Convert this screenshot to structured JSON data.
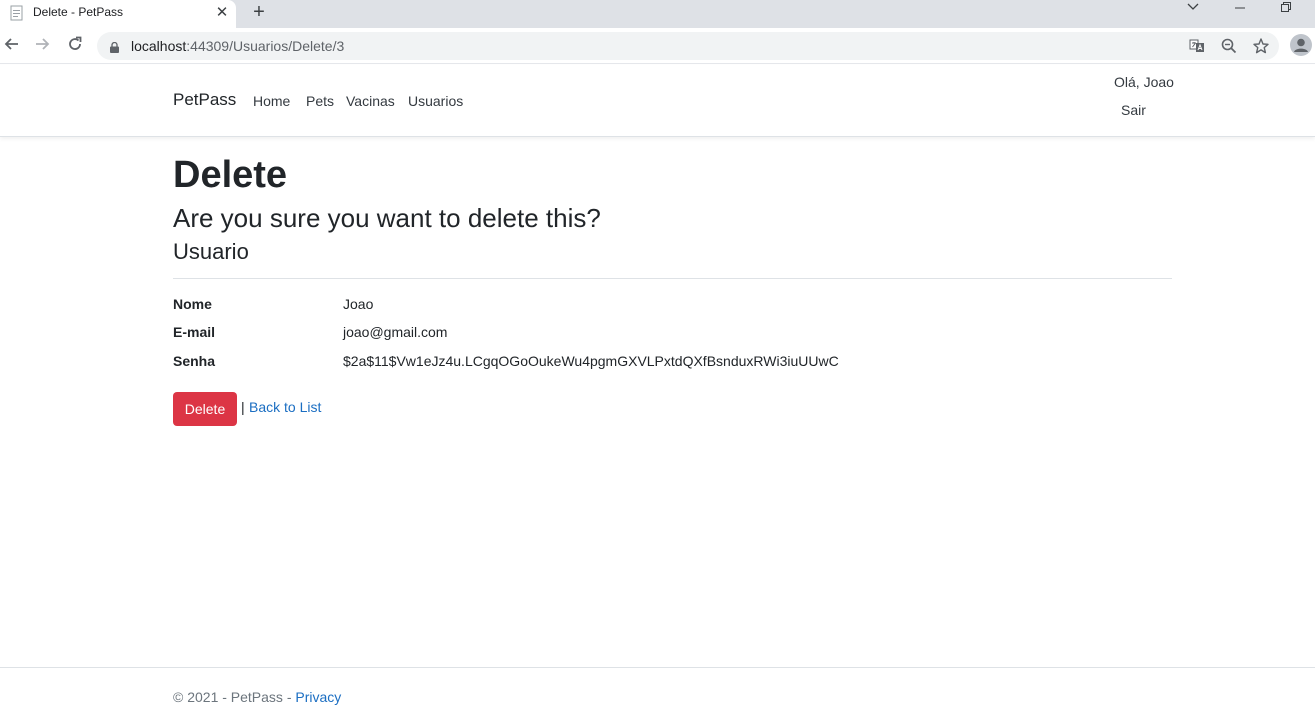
{
  "browser": {
    "tab_title": "Delete - PetPass",
    "tab_close": "✕",
    "new_tab": "+",
    "url_host": "localhost",
    "url_path": ":44309/Usuarios/Delete/3"
  },
  "navbar": {
    "brand": "PetPass",
    "links": [
      "Home",
      "Pets",
      "Vacinas",
      "Usuarios"
    ],
    "greeting": "Olá, Joao",
    "logout": "Sair"
  },
  "page": {
    "title": "Delete",
    "question": "Are you sure you want to delete this?",
    "entity": "Usuario",
    "fields": [
      {
        "label": "Nome",
        "value": "Joao"
      },
      {
        "label": "E-mail",
        "value": "joao@gmail.com"
      },
      {
        "label": "Senha",
        "value": "$2a$11$Vw1eJz4u.LCgqOGoOukeWu4pgmGXVLPxtdQXfBsnduxRWi3iuUUwC"
      }
    ],
    "delete_button": "Delete",
    "separator": "|",
    "back_link": "Back to List"
  },
  "footer": {
    "copyright": "© 2021 - PetPass - ",
    "privacy": "Privacy"
  },
  "colors": {
    "danger": "#dc3545",
    "link": "#1b6ec2"
  }
}
